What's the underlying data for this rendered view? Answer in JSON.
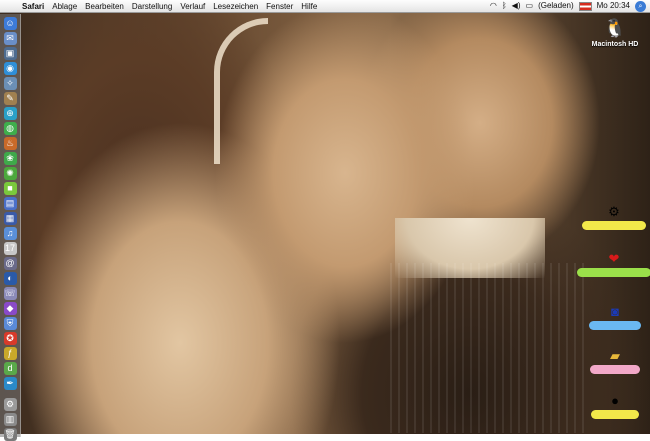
{
  "menubar": {
    "app_menu": "Safari",
    "menus": [
      "Ablage",
      "Bearbeiten",
      "Darstellung",
      "Verlauf",
      "Lesezeichen",
      "Fenster",
      "Hilfe"
    ],
    "battery_status": "(Geladen)",
    "clock": "Mo 20:34"
  },
  "desktop": {
    "hard_drive_label": "Macintosh HD"
  },
  "dock": {
    "items": [
      {
        "icon": "finder-icon",
        "glyph": "☺",
        "color": "#3d7bd8"
      },
      {
        "icon": "app-icon",
        "glyph": "✉",
        "color": "#6a8fc8"
      },
      {
        "icon": "photo-icon",
        "glyph": "▣",
        "color": "#4d6b8f"
      },
      {
        "icon": "preview-icon",
        "glyph": "◉",
        "color": "#2f8fd8"
      },
      {
        "icon": "compass-icon",
        "glyph": "✧",
        "color": "#6b8fb5"
      },
      {
        "icon": "notes-icon",
        "glyph": "✎",
        "color": "#a08050"
      },
      {
        "icon": "safari-icon",
        "glyph": "⊕",
        "color": "#2aa0c8"
      },
      {
        "icon": "globe-icon",
        "glyph": "◍",
        "color": "#3fae4c"
      },
      {
        "icon": "candle-icon",
        "glyph": "♨",
        "color": "#c86a2a"
      },
      {
        "icon": "leaf-icon",
        "glyph": "❀",
        "color": "#3fa84a"
      },
      {
        "icon": "star-icon",
        "glyph": "✺",
        "color": "#4ca83c"
      },
      {
        "icon": "green-square-icon",
        "glyph": "■",
        "color": "#7ac83c"
      },
      {
        "icon": "movie-icon",
        "glyph": "▤",
        "color": "#4a6fc8"
      },
      {
        "icon": "clapper-icon",
        "glyph": "▦",
        "color": "#3a5aa8"
      },
      {
        "icon": "music-icon",
        "glyph": "♫",
        "color": "#5a8fd8"
      },
      {
        "icon": "calendar-icon",
        "glyph": "17",
        "color": "#c8c8c8"
      },
      {
        "icon": "address-book-icon",
        "glyph": "@",
        "color": "#6a6a8a"
      },
      {
        "icon": "earth-icon",
        "glyph": "◐",
        "color": "#2a5aa8"
      },
      {
        "icon": "chat-icon",
        "glyph": "☏",
        "color": "#8a8ab8"
      },
      {
        "icon": "purple-app-icon",
        "glyph": "◆",
        "color": "#8a4ac8"
      },
      {
        "icon": "shield-icon",
        "glyph": "⛨",
        "color": "#5a8ad8"
      },
      {
        "icon": "red-app-icon",
        "glyph": "✪",
        "color": "#d83a2a"
      },
      {
        "icon": "flash-icon",
        "glyph": "ƒ",
        "color": "#c8a82a"
      },
      {
        "icon": "dreamweaver-icon",
        "glyph": "d",
        "color": "#5aa84a"
      },
      {
        "icon": "pen-icon",
        "glyph": "✒",
        "color": "#2a8ac8"
      }
    ],
    "trash_items": [
      {
        "icon": "system-icon",
        "glyph": "⚙",
        "color": "#9a9a9a"
      },
      {
        "icon": "downloads-icon",
        "glyph": "▥",
        "color": "#8a8a8a"
      },
      {
        "icon": "trash-icon",
        "glyph": "🗑",
        "color": "#7a7a7a"
      }
    ]
  },
  "colors": {
    "menubar_bg": "#eeeeee",
    "dock_bg": "#787878",
    "blob_yellow": "#f2e84a",
    "blob_green": "#9be04a",
    "blob_blue": "#6ab8f2",
    "blob_pink": "#f2a8c8"
  }
}
